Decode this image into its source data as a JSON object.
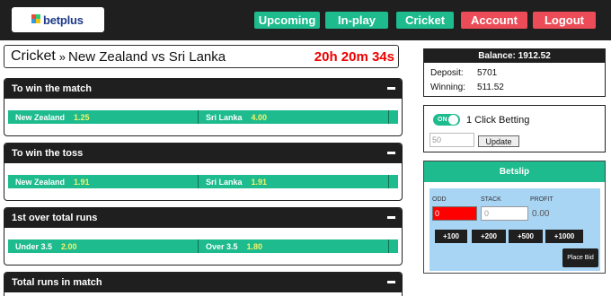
{
  "header": {
    "logo_text": "betplus",
    "nav": [
      {
        "label": "Upcoming"
      },
      {
        "label": "In-play"
      },
      {
        "label": "Cricket"
      },
      {
        "label": "Account"
      },
      {
        "label": "Logout"
      }
    ]
  },
  "match": {
    "sport": "Cricket",
    "separator": "»",
    "title": "New Zealand vs Sri Lanka",
    "countdown": "20h 20m 34s"
  },
  "markets": [
    {
      "title": "To win the match",
      "odds": [
        {
          "name": "New Zealand",
          "value": "1.25"
        },
        {
          "name": "Sri Lanka",
          "value": "4.00"
        }
      ]
    },
    {
      "title": "To win the toss",
      "odds": [
        {
          "name": "New Zealand",
          "value": "1.91"
        },
        {
          "name": "Sri Lanka",
          "value": "1.91"
        }
      ]
    },
    {
      "title": "1st over total runs",
      "odds": [
        {
          "name": "Under 3.5",
          "value": "2.00"
        },
        {
          "name": "Over 3.5",
          "value": "1.80"
        }
      ]
    },
    {
      "title": "Total runs in match",
      "odds": []
    }
  ],
  "account": {
    "balance_label": "Balance: 1912.52",
    "deposit_label": "Deposit:",
    "deposit_value": "5701",
    "winning_label": "Winning:",
    "winning_value": "511.52"
  },
  "one_click": {
    "toggle_text": "ON",
    "label": "1 Click Betting",
    "stake_value": "50",
    "update_label": "Update"
  },
  "betslip": {
    "title": "Betslip",
    "odd_label": "ODD",
    "stack_label": "STACK",
    "profit_label": "PROFIT",
    "odd_value": "0",
    "stack_placeholder": "0",
    "profit_value": "0.00",
    "quick_stakes": [
      "+100",
      "+200",
      "+500",
      "+1000"
    ],
    "place_bid_label": "Place Bid"
  },
  "colors": {
    "accent_green": "#1dbb8d",
    "accent_red": "#ec4c57",
    "dark": "#1f1f1f",
    "betslip_bg": "#a9d5f5",
    "countdown": "#e00000"
  }
}
